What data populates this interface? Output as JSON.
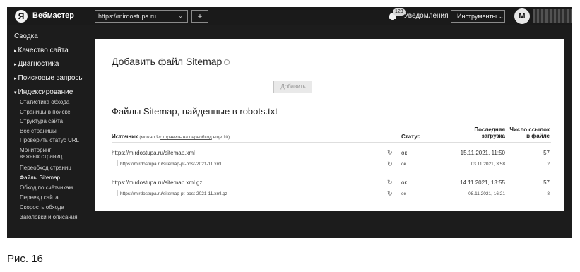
{
  "header": {
    "logo_letter": "Я",
    "brand": "Вебмастер",
    "site": "https://mirdostupa.ru",
    "site_caret": "⌄",
    "add_site": "+",
    "notif_count": "123",
    "notifications": "Уведомления",
    "tools": "Инструменты ⌄",
    "avatar_letter": "M"
  },
  "sidebar": {
    "items": [
      {
        "label": "Сводка",
        "arrow": ""
      },
      {
        "label": "Качество сайта",
        "arrow": "▸"
      },
      {
        "label": "Диагностика",
        "arrow": "▸"
      },
      {
        "label": "Поисковые запросы",
        "arrow": "▸"
      },
      {
        "label": "Индексирование",
        "arrow": "▾"
      }
    ],
    "sub_items": [
      "Статистика обхода",
      "Страницы в поиске",
      "Структура сайта",
      "Все страницы",
      "Проверить статус URL",
      "Мониторинг",
      "важных страниц",
      "Переобход страниц",
      "Файлы Sitemap",
      "Обход по счётчикам",
      "Переезд сайта",
      "Скорость обхода",
      "Заголовки и описания"
    ]
  },
  "main": {
    "add_title": "Добавить файл Sitemap",
    "info_icon": "i",
    "add_button": "Добавить",
    "found_title": "Файлы Sitemap, найденные в robots.txt",
    "table": {
      "col_source": "Источник",
      "col_source_note_pre": "(можно",
      "col_source_note_link": "отправить на переобход",
      "col_source_note_post": "еще 10)",
      "col_status": "Статус",
      "col_last_1": "Последняя",
      "col_last_2": "загрузка",
      "col_links_1": "Число ссылок",
      "col_links_2": "в файле",
      "rows": [
        {
          "source": "https://mirdostupa.ru/sitemap.xml",
          "status": "ок",
          "date": "15.11.2021, 11:50",
          "links": "57",
          "child": false
        },
        {
          "source": "https://mirdostupa.ru/sitemap-pt-post-2021-11.xml",
          "status": "ок",
          "date": "03.11.2021, 3:58",
          "links": "2",
          "child": true
        },
        {
          "source": "https://mirdostupa.ru/sitemap.xml.gz",
          "status": "ок",
          "date": "14.11.2021, 13:55",
          "links": "57",
          "child": false
        },
        {
          "source": "https://mirdostupa.ru/sitemap-pt-post-2021-11.xml.gz",
          "status": "ок",
          "date": "08.11.2021, 16:21",
          "links": "8",
          "child": true
        }
      ]
    }
  },
  "caption": "Рис. 16"
}
